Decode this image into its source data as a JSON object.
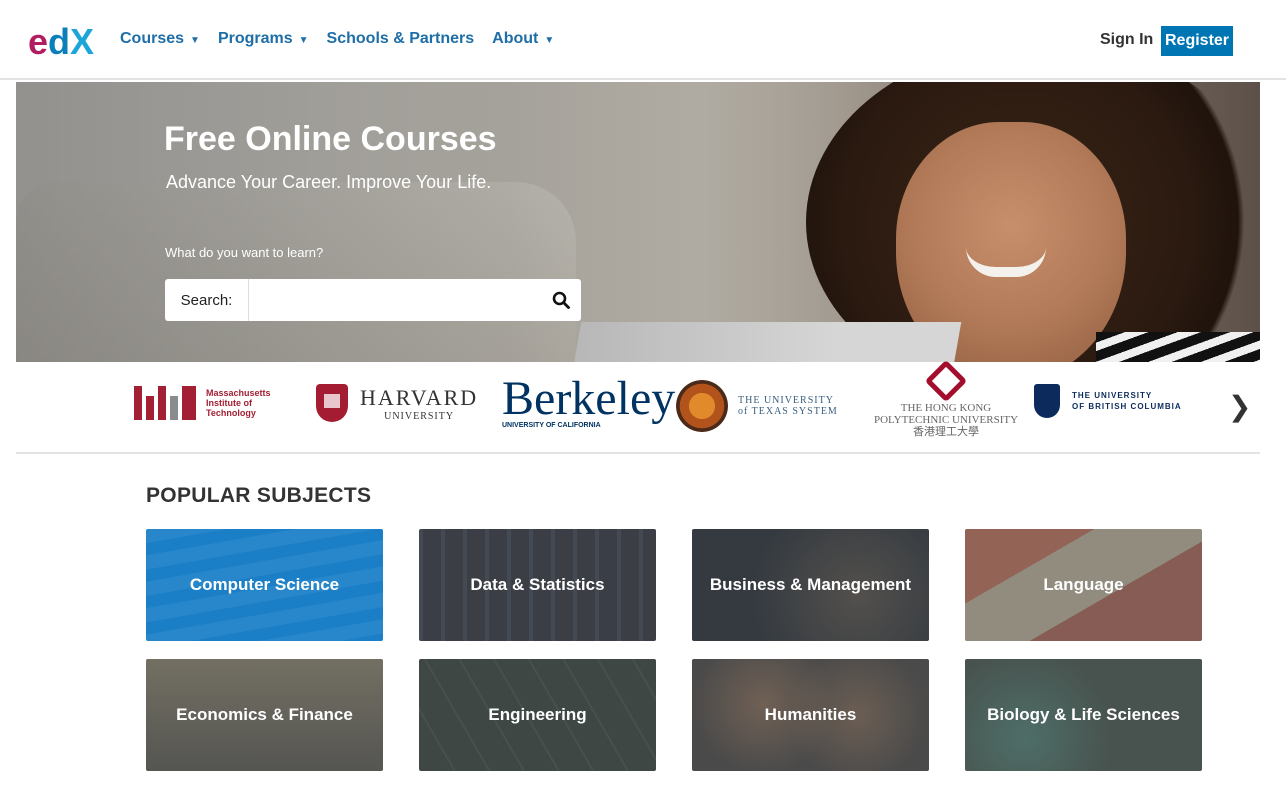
{
  "brand": {
    "logo": "edX",
    "accent": "#0075b4"
  },
  "nav": {
    "items": [
      {
        "label": "Courses",
        "caret": true
      },
      {
        "label": "Programs",
        "caret": true
      },
      {
        "label": "Schools & Partners",
        "caret": false
      },
      {
        "label": "About",
        "caret": true
      }
    ],
    "sign_in": "Sign In",
    "register": "Register"
  },
  "hero": {
    "title": "Free Online Courses",
    "subtitle": "Advance Your Career. Improve Your Life.",
    "question": "What do you want to learn?",
    "search_label": "Search:",
    "search_value": "",
    "search_icon": "search-icon"
  },
  "partners": {
    "mit": {
      "line1": "Massachusetts",
      "line2": "Institute of",
      "line3": "Technology"
    },
    "harvard": {
      "line1": "HARVARD",
      "line2": "UNIVERSITY"
    },
    "berkeley": {
      "line1": "Berkeley",
      "line2": "UNIVERSITY OF CALIFORNIA"
    },
    "texas": {
      "line1": "THE UNIVERSITY",
      "line2": "of TEXAS SYSTEM"
    },
    "hongkong": {
      "line1": "THE HONG KONG",
      "line2": "POLYTECHNIC UNIVERSITY",
      "line3": "香港理工大學"
    },
    "ubc": {
      "line1": "THE UNIVERSITY",
      "line2": "OF BRITISH COLUMBIA"
    },
    "next_icon": "chevron-right-icon"
  },
  "subjects": {
    "title": "POPULAR SUBJECTS",
    "tiles": [
      {
        "label": "Computer Science"
      },
      {
        "label": "Data & Statistics"
      },
      {
        "label": "Business & Management"
      },
      {
        "label": "Language"
      },
      {
        "label": "Economics & Finance"
      },
      {
        "label": "Engineering"
      },
      {
        "label": "Humanities"
      },
      {
        "label": "Biology & Life Sciences"
      }
    ]
  }
}
